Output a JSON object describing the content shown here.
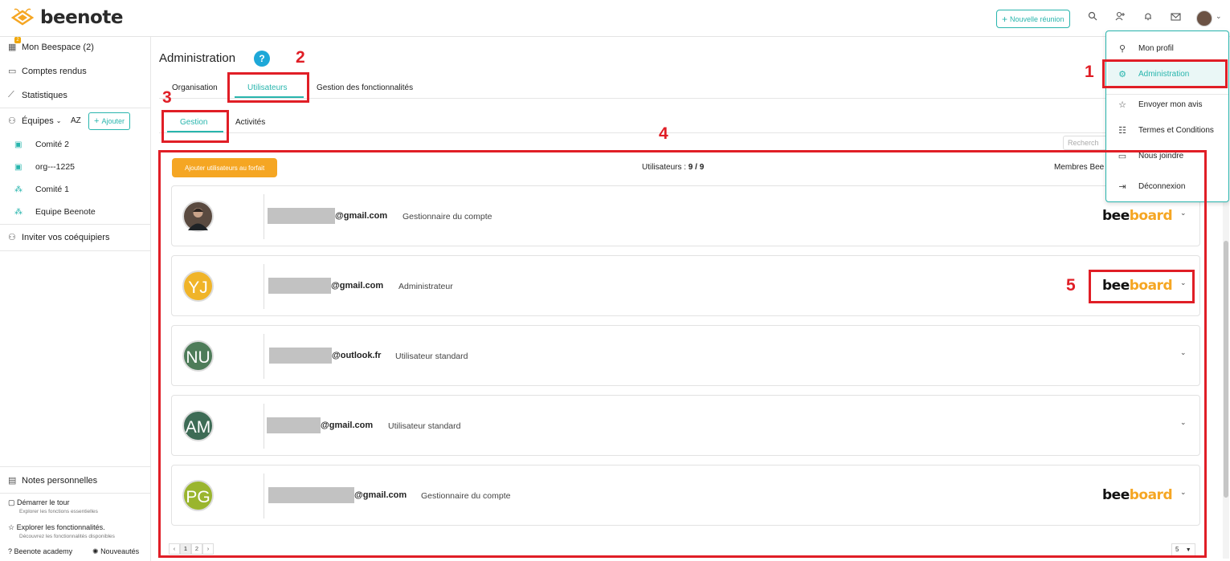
{
  "app": {
    "name": "beenote"
  },
  "topbar": {
    "new_meeting": "Nouvelle réunion",
    "icons": [
      "search-icon",
      "add-user-icon",
      "bell-icon",
      "mail-icon",
      "avatar",
      "chevron-down-icon"
    ]
  },
  "sidebar": {
    "beespace": "Mon Beespace (2)",
    "beespace_badge": "2",
    "comptes": "Comptes rendus",
    "stats": "Statistiques",
    "equipes": "Équipes",
    "sort": "AZ",
    "ajouter": "Ajouter",
    "teams": [
      "Comité 2",
      "org---1225",
      "Comité 1",
      "Equipe Beenote"
    ],
    "invite": "Inviter vos coéquipiers",
    "notes": "Notes personnelles",
    "tour": {
      "label": "Démarrer le tour",
      "sub": "Explorer les fonctions essentielles"
    },
    "explore": {
      "label": "Explorer les fonctionnalités.",
      "sub": "Découvrez les fonctionnalités disponibles"
    },
    "academy": "Beenote academy",
    "news": "Nouveautés"
  },
  "main": {
    "title": "Administration",
    "help": "?",
    "tabs": [
      "Organisation",
      "Utilisateurs",
      "Gestion des fonctionnalités"
    ],
    "subtabs": [
      "Gestion",
      "Activités"
    ],
    "search_placeholder": "Recherch",
    "add_plan": "Ajouter utilisateurs au forfait",
    "count_label": "Utilisateurs :",
    "count_value": "9 / 9",
    "members_label": "Membres Bee",
    "users": [
      {
        "initials": "",
        "email": "@gmail.com",
        "role": "Gestionnaire du compte",
        "beeboard": true,
        "color": "#5a4a40"
      },
      {
        "initials": "YJ",
        "email": "@gmail.com",
        "role": "Administrateur",
        "beeboard": true,
        "color": "#f0b429"
      },
      {
        "initials": "NU",
        "email": "@outlook.fr",
        "role": "Utilisateur standard",
        "beeboard": false,
        "color": "#4e7c59"
      },
      {
        "initials": "AM",
        "email": "@gmail.com",
        "role": "Utilisateur standard",
        "beeboard": false,
        "color": "#3d6b55"
      },
      {
        "initials": "PG",
        "email": "@gmail.com",
        "role": "Gestionnaire du compte",
        "beeboard": true,
        "color": "#9ab52e"
      }
    ],
    "beeboard": {
      "part1": "bee",
      "part2": "board"
    },
    "pager": [
      "‹",
      "1",
      "2",
      "›"
    ],
    "per_page": "5"
  },
  "dropdown": {
    "items": [
      "Mon profil",
      "Administration",
      "Envoyer mon avis",
      "Termes et Conditions",
      "Nous joindre",
      "Déconnexion"
    ]
  },
  "annotations": [
    "1",
    "2",
    "3",
    "4",
    "5"
  ],
  "colors": {
    "accent": "#28b5ad",
    "orange": "#f5a623",
    "annotation": "#e01e26"
  }
}
